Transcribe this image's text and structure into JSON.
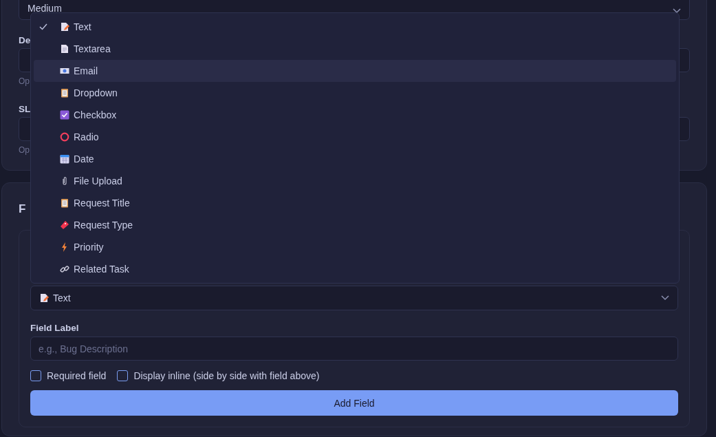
{
  "top_section": {
    "priority_select": {
      "value": "Medium"
    },
    "fields": [
      {
        "label": "De",
        "hint": "Op"
      },
      {
        "label": "SL",
        "hint": "Op"
      }
    ]
  },
  "form_section": {
    "heading": "F",
    "type_select": {
      "value": "Text",
      "kind": "text"
    },
    "field_label": {
      "label": "Field Label",
      "placeholder": "e.g., Bug Description"
    },
    "options": [
      {
        "label": "Required field",
        "checked": false
      },
      {
        "label": "Display inline (side by side with field above)",
        "checked": false
      }
    ],
    "add_button": "Add Field"
  },
  "type_menu": [
    {
      "label": "Text",
      "kind": "text",
      "selected": true,
      "highlighted": false
    },
    {
      "label": "Textarea",
      "kind": "textarea",
      "selected": false,
      "highlighted": false
    },
    {
      "label": "Email",
      "kind": "email",
      "selected": false,
      "highlighted": true
    },
    {
      "label": "Dropdown",
      "kind": "dropdown",
      "selected": false,
      "highlighted": false
    },
    {
      "label": "Checkbox",
      "kind": "checkbox",
      "selected": false,
      "highlighted": false
    },
    {
      "label": "Radio",
      "kind": "radio",
      "selected": false,
      "highlighted": false
    },
    {
      "label": "Date",
      "kind": "date",
      "selected": false,
      "highlighted": false
    },
    {
      "label": "File Upload",
      "kind": "file",
      "selected": false,
      "highlighted": false
    },
    {
      "label": "Request Title",
      "kind": "title",
      "selected": false,
      "highlighted": false
    },
    {
      "label": "Request Type",
      "kind": "type",
      "selected": false,
      "highlighted": false
    },
    {
      "label": "Priority",
      "kind": "priority",
      "selected": false,
      "highlighted": false
    },
    {
      "label": "Related Task",
      "kind": "task",
      "selected": false,
      "highlighted": false
    }
  ]
}
